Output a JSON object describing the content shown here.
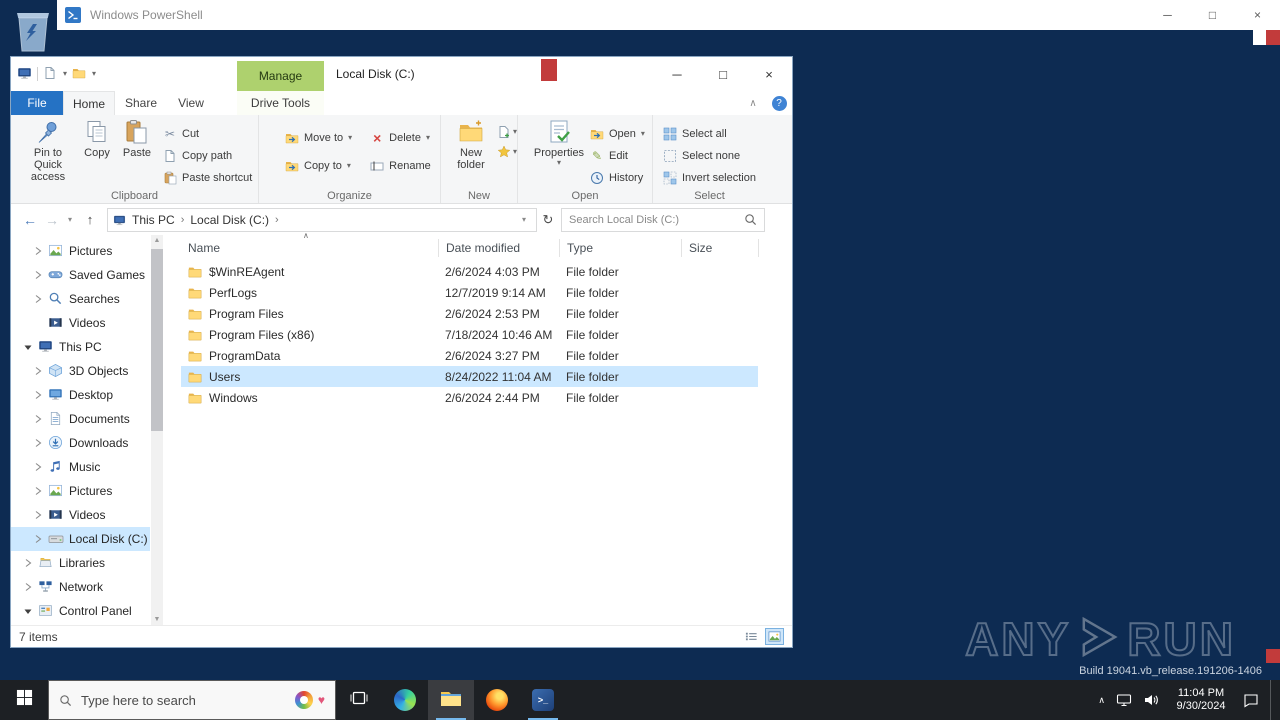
{
  "icons": {
    "minimize": "─",
    "maximize": "□",
    "close": "×",
    "back": "←",
    "forward": "→",
    "up_arrow": "↑",
    "dropdown": "▾",
    "crumb_sep": "›",
    "refresh": "↻",
    "collapse_ribbon": "∧",
    "help": "?",
    "sort_asc": "∧",
    "tray_chevron": "∧",
    "cut": "✂",
    "delete": "×",
    "edit_pencil": "✎",
    "scroll_up": "▲",
    "scroll_down": "▼"
  },
  "ps": {
    "title": "Windows PowerShell"
  },
  "explorer": {
    "title": "Local Disk (C:)",
    "manage": "Manage",
    "tabs": {
      "file": "File",
      "home": "Home",
      "share": "Share",
      "view": "View",
      "drive_tools": "Drive Tools"
    },
    "ribbon": {
      "pin": "Pin to Quick access",
      "copy": "Copy",
      "paste": "Paste",
      "cut": "Cut",
      "copy_path": "Copy path",
      "paste_shortcut": "Paste shortcut",
      "move_to": "Move to",
      "copy_to": "Copy to",
      "delete": "Delete",
      "rename": "Rename",
      "new_folder": "New folder",
      "properties": "Properties",
      "open": "Open",
      "edit": "Edit",
      "history": "History",
      "select_all": "Select all",
      "select_none": "Select none",
      "invert_selection": "Invert selection",
      "groups": {
        "clipboard": "Clipboard",
        "organize": "Organize",
        "new": "New",
        "open": "Open",
        "select": "Select"
      }
    },
    "address": {
      "crumb_root": "This PC",
      "crumb_current": "Local Disk (C:)",
      "search_placeholder": "Search Local Disk (C:)"
    },
    "columns": [
      "Name",
      "Date modified",
      "Type",
      "Size"
    ],
    "files": [
      {
        "name": "$WinREAgent",
        "date": "2/6/2024 4:03 PM",
        "type": "File folder",
        "selected": false
      },
      {
        "name": "PerfLogs",
        "date": "12/7/2019 9:14 AM",
        "type": "File folder",
        "selected": false
      },
      {
        "name": "Program Files",
        "date": "2/6/2024 2:53 PM",
        "type": "File folder",
        "selected": false
      },
      {
        "name": "Program Files (x86)",
        "date": "7/18/2024 10:46 AM",
        "type": "File folder",
        "selected": false
      },
      {
        "name": "ProgramData",
        "date": "2/6/2024 3:27 PM",
        "type": "File folder",
        "selected": false
      },
      {
        "name": "Users",
        "date": "8/24/2022 11:04 AM",
        "type": "File folder",
        "selected": true
      },
      {
        "name": "Windows",
        "date": "2/6/2024 2:44 PM",
        "type": "File folder",
        "selected": false
      }
    ],
    "nav": [
      {
        "label": "Pictures",
        "icon": "picture",
        "chevron": "right",
        "indent": 2,
        "selected": false
      },
      {
        "label": "Saved Games",
        "icon": "saved-games",
        "chevron": "right",
        "indent": 2,
        "selected": false
      },
      {
        "label": "Searches",
        "icon": "search",
        "chevron": "right",
        "indent": 2,
        "selected": false
      },
      {
        "label": "Videos",
        "icon": "video",
        "chevron": "none",
        "indent": 2,
        "selected": false
      },
      {
        "label": "This PC",
        "icon": "monitor",
        "chevron": "down",
        "indent": 1,
        "selected": false
      },
      {
        "label": "3D Objects",
        "icon": "cube",
        "chevron": "right",
        "indent": 2,
        "selected": false
      },
      {
        "label": "Desktop",
        "icon": "desktop",
        "chevron": "right",
        "indent": 2,
        "selected": false
      },
      {
        "label": "Documents",
        "icon": "document",
        "chevron": "right",
        "indent": 2,
        "selected": false
      },
      {
        "label": "Downloads",
        "icon": "download",
        "chevron": "right",
        "indent": 2,
        "selected": false
      },
      {
        "label": "Music",
        "icon": "music",
        "chevron": "right",
        "indent": 2,
        "selected": false
      },
      {
        "label": "Pictures",
        "icon": "picture",
        "chevron": "right",
        "indent": 2,
        "selected": false
      },
      {
        "label": "Videos",
        "icon": "video",
        "chevron": "right",
        "indent": 2,
        "selected": false
      },
      {
        "label": "Local Disk (C:)",
        "icon": "drive",
        "chevron": "right",
        "indent": 2,
        "selected": true
      },
      {
        "label": "Libraries",
        "icon": "libraries",
        "chevron": "right",
        "indent": 1,
        "selected": false
      },
      {
        "label": "Network",
        "icon": "network",
        "chevron": "right",
        "indent": 1,
        "selected": false
      },
      {
        "label": "Control Panel",
        "icon": "control-panel",
        "chevron": "down",
        "indent": 1,
        "selected": false
      }
    ],
    "status": {
      "items_count": "7 items"
    }
  },
  "watermark": {
    "any": "ANY",
    "run": "RUN",
    "build": "Build 19041.vb_release.191206-1406"
  },
  "taskbar": {
    "search_placeholder": "Type here to search",
    "time": "11:04 PM",
    "date": "9/30/2024"
  }
}
